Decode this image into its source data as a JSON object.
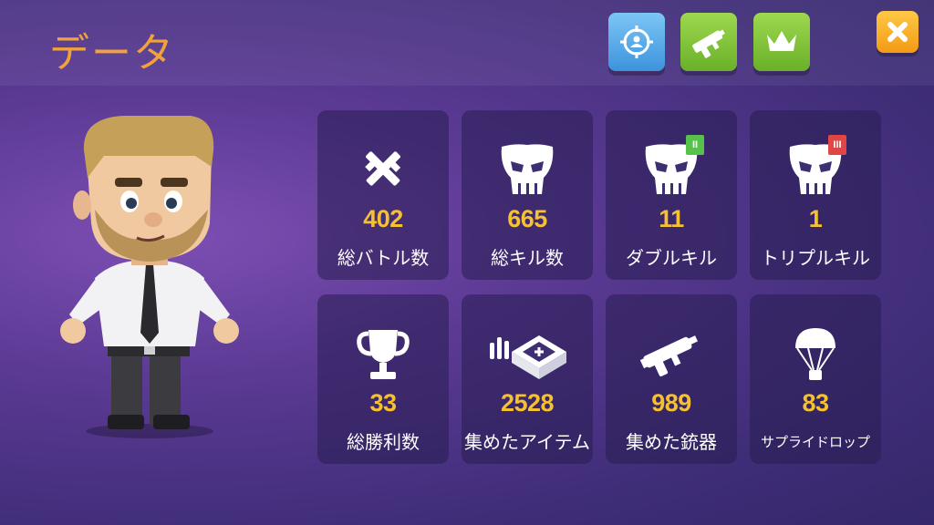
{
  "header": {
    "title": "データ",
    "tabs": [
      {
        "icon": "crosshair-user-icon",
        "color": "#4aa4e6"
      },
      {
        "icon": "gun-icon",
        "color": "#7ac23a"
      },
      {
        "icon": "crown-icon",
        "color": "#7ac23a"
      }
    ],
    "close_icon": "close-icon"
  },
  "stats": [
    {
      "value": "402",
      "label": "総バトル数",
      "icon": "crossed-guns-icon"
    },
    {
      "value": "665",
      "label": "総キル数",
      "icon": "skull-icon"
    },
    {
      "value": "11",
      "label": "ダブルキル",
      "icon": "skull-icon",
      "badge": "II"
    },
    {
      "value": "1",
      "label": "トリプルキル",
      "icon": "skull-icon",
      "badge": "III"
    },
    {
      "value": "33",
      "label": "総勝利数",
      "icon": "trophy-icon"
    },
    {
      "value": "2528",
      "label": "集めたアイテム",
      "icon": "item-crate-icon"
    },
    {
      "value": "989",
      "label": "集めた銃器",
      "icon": "gun-icon"
    },
    {
      "value": "83",
      "label": "サプライドロップ",
      "icon": "parachute-icon"
    }
  ],
  "colors": {
    "title": "#f2a23b",
    "value": "#f5c133",
    "badge_double": "#57c24a",
    "badge_triple": "#e04646"
  }
}
